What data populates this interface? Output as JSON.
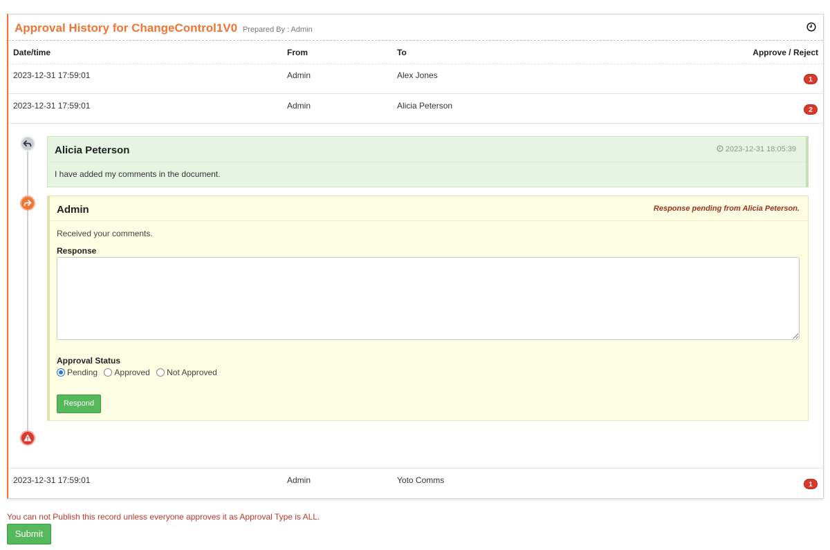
{
  "header": {
    "title": "Approval History for ChangeControl1V0",
    "subtitle": "Prepared By : Admin",
    "history_icon": "clock-icon"
  },
  "table": {
    "columns": [
      "Date/time",
      "From",
      "To",
      "Approve / Reject"
    ],
    "rows": [
      {
        "datetime": "2023-12-31 17:59:01",
        "from": "Admin",
        "to": "Alex Jones",
        "badge": "1"
      },
      {
        "datetime": "2023-12-31 17:59:01",
        "from": "Admin",
        "to": "Alicia Peterson",
        "badge": "2"
      },
      {
        "datetime": "2023-12-31 17:59:01",
        "from": "Admin",
        "to": "Yoto Comms",
        "badge": "1"
      }
    ]
  },
  "timeline": {
    "reply": {
      "icon": "reply-icon",
      "name": "Alicia Peterson",
      "timestamp": "2023-12-31 18:05:39",
      "message": "I have added my comments in the document."
    },
    "forward": {
      "icon": "forward-icon",
      "name": "Admin",
      "status_note": "Response pending from Alicia Peterson.",
      "message": "Received your comments.",
      "response_label": "Response",
      "response_value": "",
      "approval_status_label": "Approval Status",
      "options": [
        "Pending",
        "Approved",
        "Not Approved"
      ],
      "selected": "Pending",
      "respond_button": "Respond"
    },
    "end_icon": "warning-icon"
  },
  "footer": {
    "warning": "You can not Publish this record unless everyone approves it as Approval Type is ALL.",
    "submit_button": "Submit"
  },
  "colors": {
    "accent": "#f07434",
    "danger": "#d9382b",
    "success": "#55b85a",
    "reply_card_bg": "#e6f5e1",
    "pending_card_bg": "#fdfde3"
  }
}
